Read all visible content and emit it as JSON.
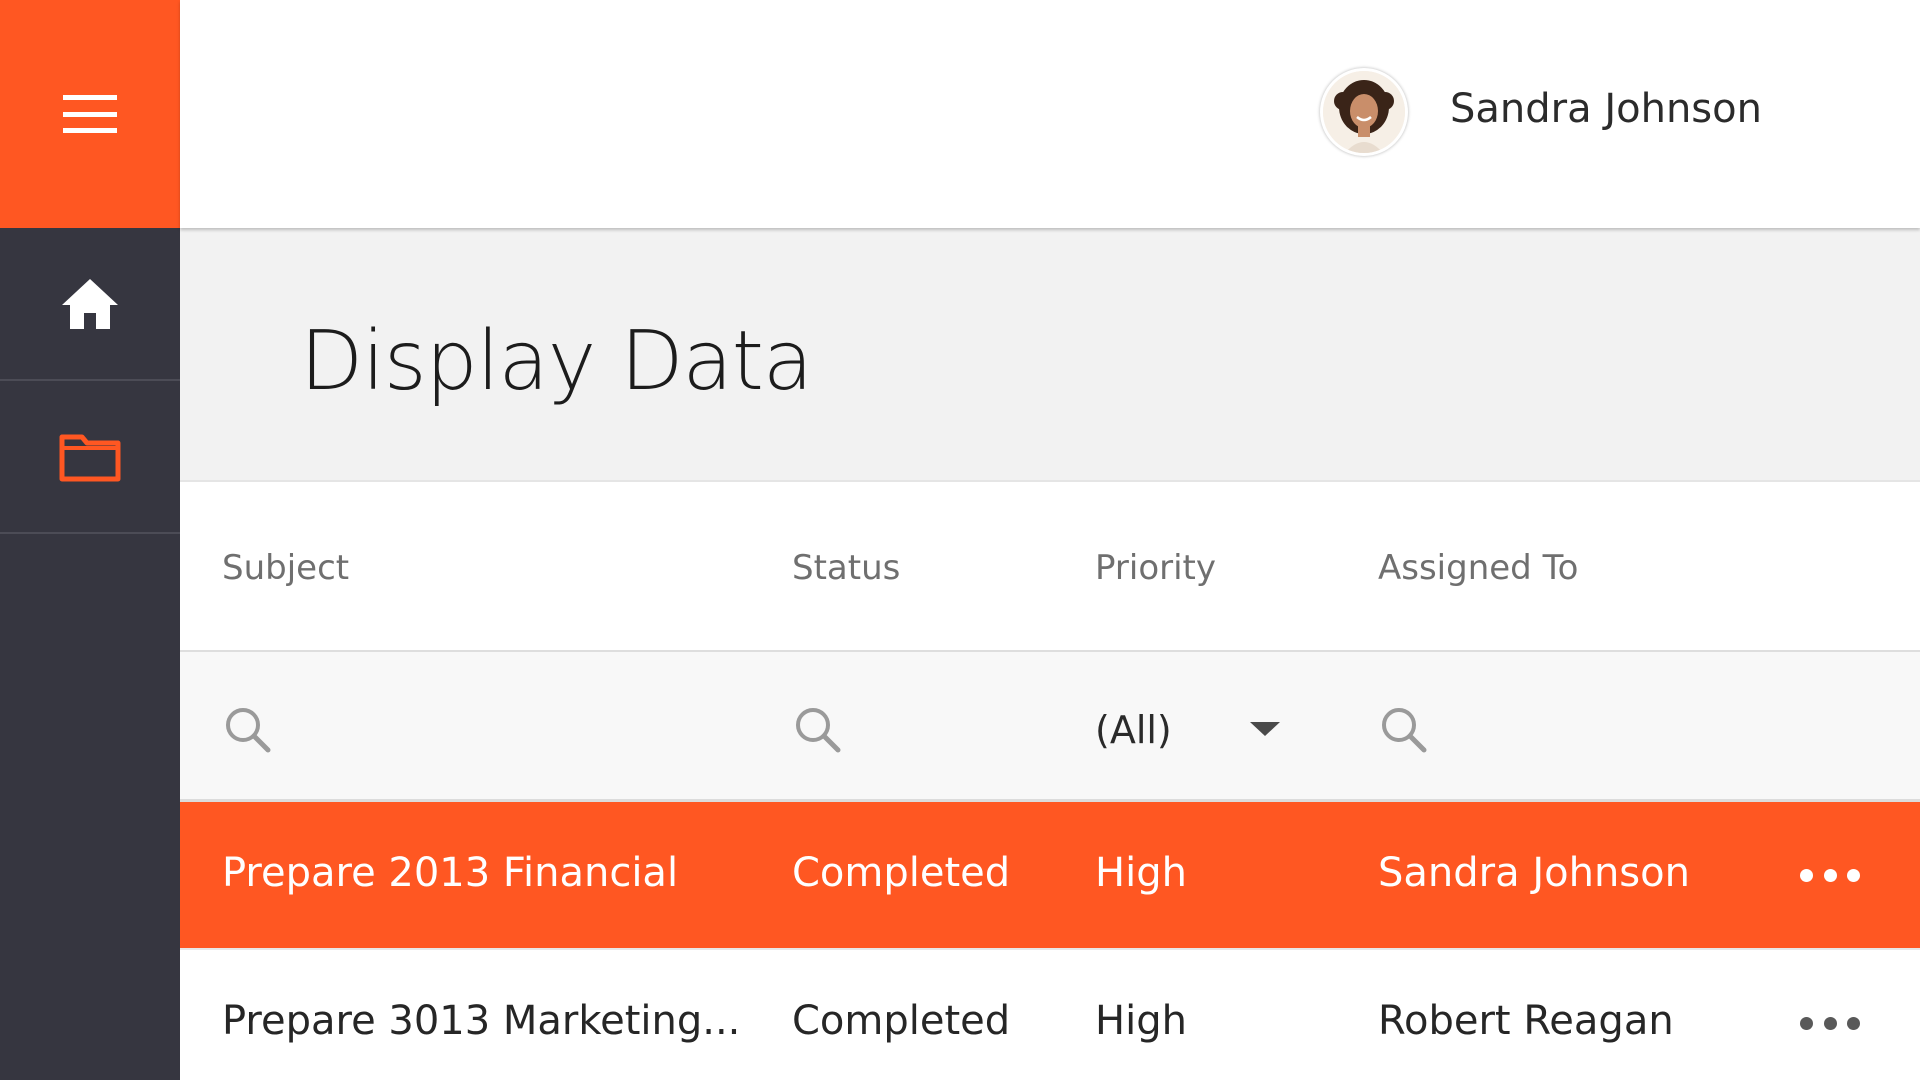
{
  "user": {
    "name": "Sandra Johnson",
    "avatar_icon": "user-avatar"
  },
  "page": {
    "title": "Display Data"
  },
  "sidebar": {
    "menu_icon": "hamburger-menu-icon",
    "items": [
      {
        "name": "home",
        "icon": "home-icon",
        "color": "#ffffff"
      },
      {
        "name": "folder",
        "icon": "folder-icon",
        "color": "#ff5722"
      }
    ]
  },
  "colors": {
    "accent": "#ff5722",
    "sidebar": "#363640",
    "title_band": "#f2f2f2"
  },
  "grid": {
    "columns": [
      "Subject",
      "Status",
      "Priority",
      "Assigned To"
    ],
    "filters": {
      "priority_value": "(All)"
    },
    "rows": [
      {
        "subject": "Prepare 2013 Financial",
        "status": "Completed",
        "priority": "High",
        "assigned_to": "Sandra Johnson",
        "selected": true
      },
      {
        "subject": "Prepare 3013 Marketing...",
        "status": "Completed",
        "priority": "High",
        "assigned_to": "Robert Reagan",
        "selected": false
      }
    ]
  }
}
